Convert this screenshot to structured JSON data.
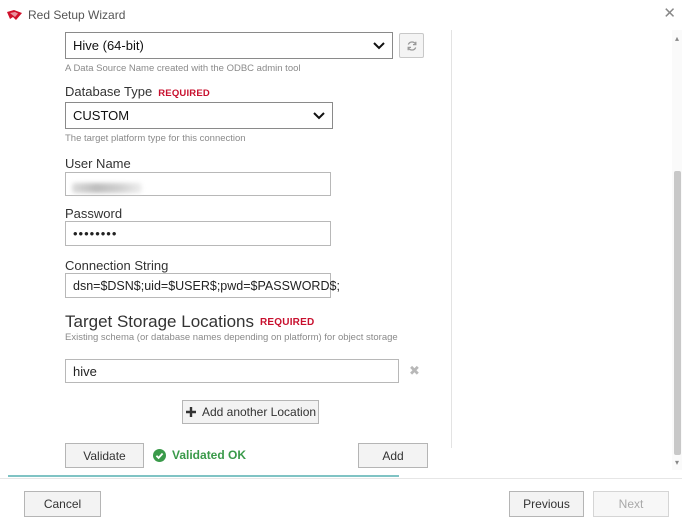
{
  "window": {
    "title": "Red Setup Wizard"
  },
  "dsn": {
    "value": "Hive (64-bit)",
    "hint": "A Data Source Name created with the ODBC admin tool"
  },
  "database_type": {
    "label": "Database Type",
    "required": "REQUIRED",
    "value": "CUSTOM",
    "hint": "The target platform type for this connection"
  },
  "user_name": {
    "label": "User Name"
  },
  "password": {
    "label": "Password",
    "value": "••••••••"
  },
  "connection_string": {
    "label": "Connection String",
    "value": "dsn=$DSN$;uid=$USER$;pwd=$PASSWORD$;"
  },
  "target_storage": {
    "title": "Target Storage Locations",
    "required": "REQUIRED",
    "hint": "Existing schema (or database names depending on platform) for object storage",
    "locations": [
      "hive"
    ],
    "add_label": "Add another Location"
  },
  "actions": {
    "validate_label": "Validate",
    "status_text": "Validated OK",
    "add_label": "Add"
  },
  "progress": {
    "fraction": 0.58
  },
  "footer": {
    "cancel_label": "Cancel",
    "previous_label": "Previous",
    "next_label": "Next"
  },
  "colors": {
    "accent_red": "#c8102e",
    "success_green": "#3a9a4a",
    "progress_teal": "#7fc3c4"
  }
}
